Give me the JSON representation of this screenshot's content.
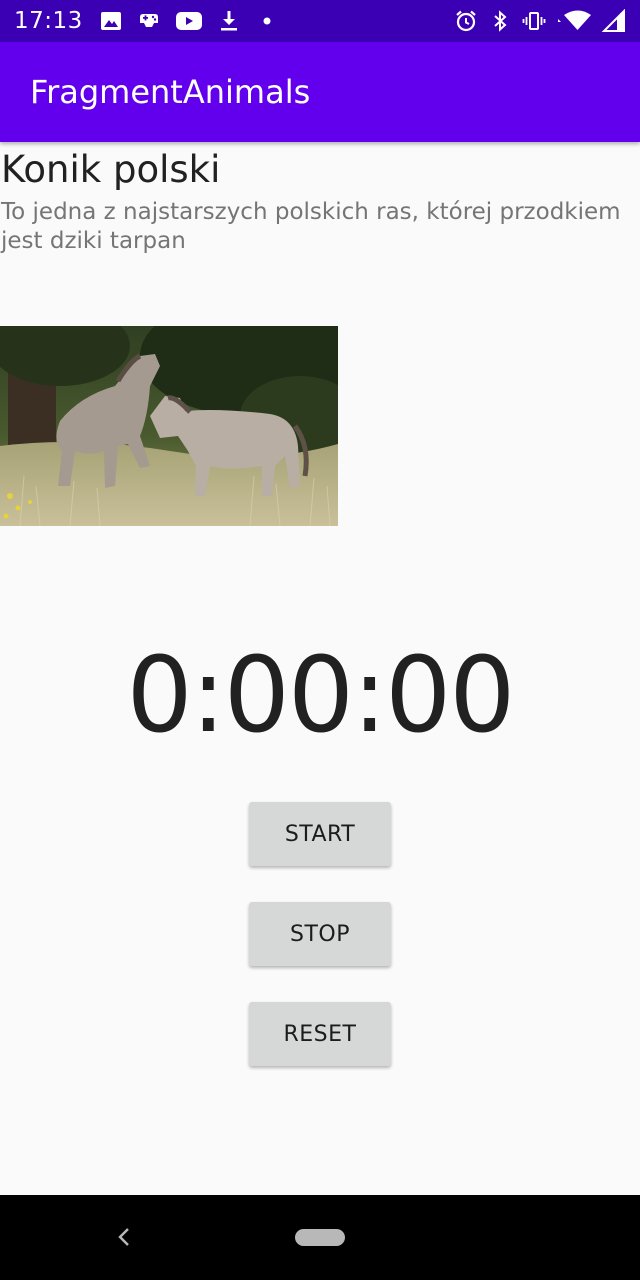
{
  "status_bar": {
    "time": "17:13",
    "left_icons": [
      "image-icon",
      "gamepad-icon",
      "youtube-icon",
      "download-icon",
      "dot-icon"
    ],
    "right_icons": [
      "alarm-icon",
      "bluetooth-icon",
      "vibrate-icon",
      "wifi-icon",
      "signal-icon"
    ]
  },
  "app_bar": {
    "title": "FragmentAnimals",
    "color": "#6200ee"
  },
  "animal": {
    "name": "Konik polski",
    "description": "To jedna z najstarszych polskich ras, której przodkiem jest dziki tarpan",
    "photo": "two-horses-photo"
  },
  "stopwatch": {
    "time": "0:00:00"
  },
  "buttons": {
    "start_label": "START",
    "stop_label": "STOP",
    "reset_label": "RESET"
  },
  "colors": {
    "status_bar": "#3c00b4",
    "accent": "#6200ee",
    "button_bg": "#d6d7d7"
  }
}
